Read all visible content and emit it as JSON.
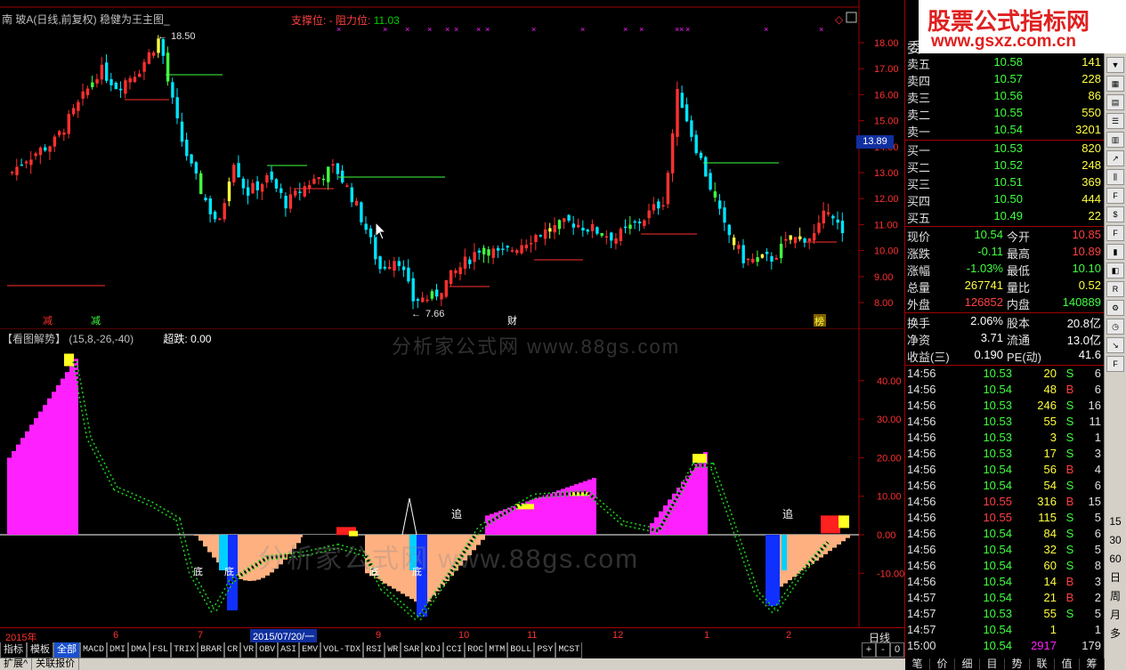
{
  "chart_title": {
    "name": "南 玻A(日线,前复权)",
    "formula": "稳健为王主图_"
  },
  "support_line": {
    "support_label": "支撑位:",
    "resist_label": "- 阻力位:",
    "resist_value": "11.03"
  },
  "price_axis": [
    "18.00",
    "17.00",
    "16.00",
    "15.00",
    "14.00",
    "13.00",
    "12.00",
    "11.00",
    "10.00",
    "9.00",
    "8.00"
  ],
  "current_price_tag": "13.89",
  "high_label": "18.50",
  "low_label": "7.66",
  "markers": {
    "m1": "减",
    "m2": "财",
    "m3": "榜"
  },
  "indicator": {
    "title": "【看图解势】",
    "params": "(15,8,-26,-40)",
    "value_label": "超跌: 0.00",
    "axis": [
      "40.00",
      "30.00",
      "20.00",
      "10.00",
      "0.00",
      "-10.00"
    ],
    "labels": {
      "chase1": "追",
      "chase2": "追",
      "bottom1": "底",
      "bottom2": "底",
      "bottom3": "底",
      "bottom4": "底"
    }
  },
  "watermarks": [
    "分析家公式网  www.88gs.com",
    "分析家公式网  www.88gs.com"
  ],
  "date_axis": {
    "labels": [
      "2015年",
      "6",
      "7",
      "9",
      "10",
      "11",
      "12",
      "1",
      "2"
    ],
    "selected": "2015/07/20/一",
    "period": "日线"
  },
  "tabs": [
    "指标",
    "模板",
    "全部",
    "MACD",
    "DMI",
    "DMA",
    "FSL",
    "TRIX",
    "BRAR",
    "CR",
    "VR",
    "OBV",
    "ASI",
    "EMV",
    "VOL-TDX",
    "RSI",
    "WR",
    "SAR",
    "KDJ",
    "CCI",
    "ROC",
    "MTM",
    "BOLL",
    "PSY",
    "MCST"
  ],
  "zoom": [
    "+",
    "-",
    "0"
  ],
  "bottom_tabs": [
    "扩展^",
    "关联报价"
  ],
  "brand": {
    "line1": "股票公式指标网",
    "line2": "www.gsxz.com.cn"
  },
  "quote": {
    "header": "委",
    "asks": [
      {
        "label": "卖五",
        "price": "10.58",
        "vol": "141"
      },
      {
        "label": "卖四",
        "price": "10.57",
        "vol": "228"
      },
      {
        "label": "卖三",
        "price": "10.56",
        "vol": "86"
      },
      {
        "label": "卖二",
        "price": "10.55",
        "vol": "550"
      },
      {
        "label": "卖一",
        "price": "10.54",
        "vol": "3201"
      }
    ],
    "bids": [
      {
        "label": "买一",
        "price": "10.53",
        "vol": "820"
      },
      {
        "label": "买二",
        "price": "10.52",
        "vol": "248"
      },
      {
        "label": "买三",
        "price": "10.51",
        "vol": "369"
      },
      {
        "label": "买四",
        "price": "10.50",
        "vol": "444"
      },
      {
        "label": "买五",
        "price": "10.49",
        "vol": "22"
      }
    ],
    "stats": [
      {
        "k1": "现价",
        "v1": "10.54",
        "k2": "今开",
        "v2": "10.85"
      },
      {
        "k1": "涨跌",
        "v1": "-0.11",
        "k2": "最高",
        "v2": "10.89"
      },
      {
        "k1": "涨幅",
        "v1": "-1.03%",
        "k2": "最低",
        "v2": "10.10"
      },
      {
        "k1": "总量",
        "v1": "267741",
        "k2": "量比",
        "v2": "0.52"
      },
      {
        "k1": "外盘",
        "v1": "126852",
        "k2": "内盘",
        "v2": "140889"
      }
    ],
    "fundamentals": [
      {
        "k1": "换手",
        "v1": "2.06%",
        "k2": "股本",
        "v2": "20.8亿"
      },
      {
        "k1": "净资",
        "v1": "3.71",
        "k2": "流通",
        "v2": "13.0亿"
      },
      {
        "k1": "收益(三)",
        "v1": "0.190",
        "k2": "PE(动)",
        "v2": "41.6"
      }
    ],
    "ticks": [
      {
        "t": "14:56",
        "p": "10.53",
        "v": "20",
        "bs": "S",
        "n": "6"
      },
      {
        "t": "14:56",
        "p": "10.54",
        "v": "48",
        "bs": "B",
        "n": "6"
      },
      {
        "t": "14:56",
        "p": "10.53",
        "v": "246",
        "bs": "S",
        "n": "16"
      },
      {
        "t": "14:56",
        "p": "10.53",
        "v": "55",
        "bs": "S",
        "n": "11"
      },
      {
        "t": "14:56",
        "p": "10.53",
        "v": "3",
        "bs": "S",
        "n": "1"
      },
      {
        "t": "14:56",
        "p": "10.53",
        "v": "17",
        "bs": "S",
        "n": "3"
      },
      {
        "t": "14:56",
        "p": "10.54",
        "v": "56",
        "bs": "B",
        "n": "4"
      },
      {
        "t": "14:56",
        "p": "10.54",
        "v": "54",
        "bs": "S",
        "n": "6"
      },
      {
        "t": "14:56",
        "p": "10.55",
        "v": "316",
        "bs": "B",
        "n": "15"
      },
      {
        "t": "14:56",
        "p": "10.55",
        "v": "115",
        "bs": "S",
        "n": "5"
      },
      {
        "t": "14:56",
        "p": "10.54",
        "v": "84",
        "bs": "S",
        "n": "6"
      },
      {
        "t": "14:56",
        "p": "10.54",
        "v": "32",
        "bs": "S",
        "n": "5"
      },
      {
        "t": "14:56",
        "p": "10.54",
        "v": "60",
        "bs": "S",
        "n": "8"
      },
      {
        "t": "14:56",
        "p": "10.54",
        "v": "14",
        "bs": "B",
        "n": "3"
      },
      {
        "t": "14:57",
        "p": "10.54",
        "v": "21",
        "bs": "B",
        "n": "2"
      },
      {
        "t": "14:57",
        "p": "10.53",
        "v": "55",
        "bs": "S",
        "n": "5"
      },
      {
        "t": "14:57",
        "p": "10.54",
        "v": "1",
        "bs": "",
        "n": "1"
      },
      {
        "t": "15:00",
        "p": "10.54",
        "v": "2917",
        "bs": "",
        "n": "179"
      }
    ],
    "footer": [
      "笔",
      "价",
      "细",
      "目",
      "势",
      "联",
      "值",
      "筹"
    ]
  },
  "toolbar_text": [
    "15",
    "30",
    "60",
    "日",
    "周",
    "月",
    "多"
  ],
  "colors": {
    "up": "#ff3030",
    "down": "#00e5ff",
    "magenta": "#ff20ff",
    "peach": "#ffb080",
    "axis": "#a00000"
  }
}
